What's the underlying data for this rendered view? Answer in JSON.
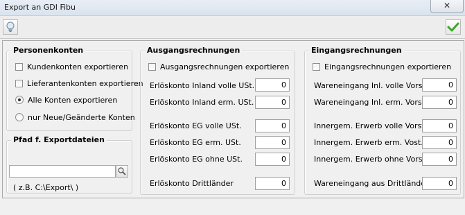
{
  "window": {
    "title": "Export an GDI Fibu",
    "close_glyph": "✕"
  },
  "toolbar": {
    "hint_icon": "lightbulb-icon",
    "ok_icon": "checkmark-icon",
    "ok_color": "#3fa52e"
  },
  "personenkonten": {
    "title": "Personenkonten",
    "kunden_label": "Kundenkonten exportieren",
    "lieferanten_label": "Lieferantenkonten exportieren",
    "alle_label": "Alle Konten exportieren",
    "neue_label": "nur Neue/Geänderte Konten",
    "selected_mode": "alle"
  },
  "pfad": {
    "title": "Pfad f. Exportdateien",
    "value": "",
    "hint": "( z.B. C:\\Export\\ )"
  },
  "ausgang": {
    "title": "Ausgangsrechnungen",
    "export_label": "Ausgangsrechnungen exportieren",
    "fields": [
      {
        "label": "Erlöskonto Inland volle USt.",
        "value": "0"
      },
      {
        "label": "Erlöskonto Inland erm. USt.",
        "value": "0"
      },
      {
        "label": "Erlöskonto EG volle USt.",
        "value": "0"
      },
      {
        "label": "Erlöskonto EG erm. USt.",
        "value": "0"
      },
      {
        "label": "Erlöskonto EG ohne USt.",
        "value": "0"
      },
      {
        "label": "Erlöskonto Drittländer",
        "value": "0"
      }
    ]
  },
  "eingang": {
    "title": "Eingangsrechnungen",
    "export_label": "Eingangsrechnungen exportieren",
    "fields": [
      {
        "label": "Wareneingang Inl. volle Vorst.",
        "value": "0"
      },
      {
        "label": "Wareneingang Inl. erm. Vorst.",
        "value": "0"
      },
      {
        "label": "Innergem. Erwerb volle Vorst.",
        "value": "0"
      },
      {
        "label": "Innergem. Erwerb erm. Vost.",
        "value": "0"
      },
      {
        "label": "Innergem. Erwerb ohne Vorst.",
        "value": "0"
      },
      {
        "label": "Wareneingang aus Drittländern",
        "value": "0"
      }
    ]
  }
}
